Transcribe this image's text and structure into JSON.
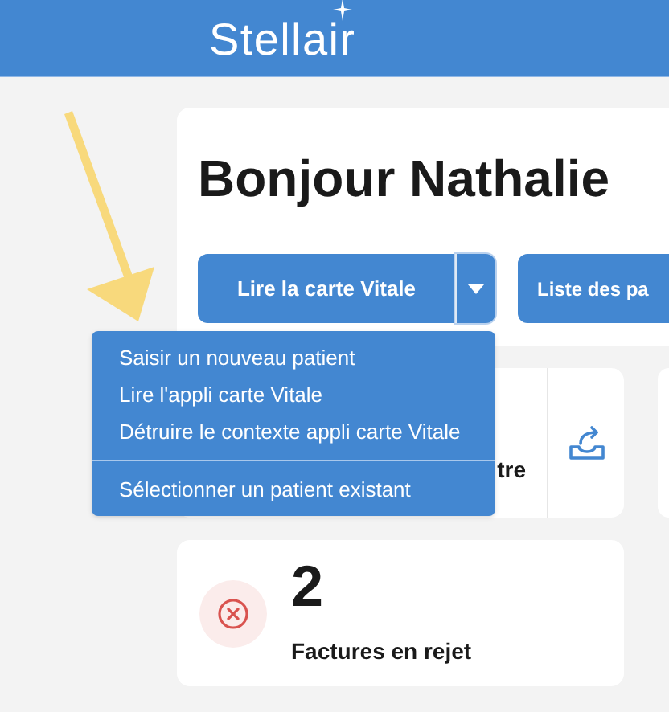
{
  "header": {
    "logo": "Stellair"
  },
  "greeting": "Bonjour Nathalie",
  "actions": [
    {
      "label": "Lire la carte Vitale",
      "kind": "split"
    },
    {
      "label": "Liste des pa",
      "kind": "plain"
    }
  ],
  "dropdown": {
    "expanded": true,
    "groups": [
      [
        "Saisir un nouveau patient",
        "Lire l'appli carte Vitale",
        "Détruire le contexte appli carte Vitale"
      ],
      [
        "Sélectionner un patient existant"
      ]
    ]
  },
  "shortcut_card": {
    "text": "tre"
  },
  "rejects_card": {
    "count": "2",
    "label": "Factures en rejet"
  }
}
